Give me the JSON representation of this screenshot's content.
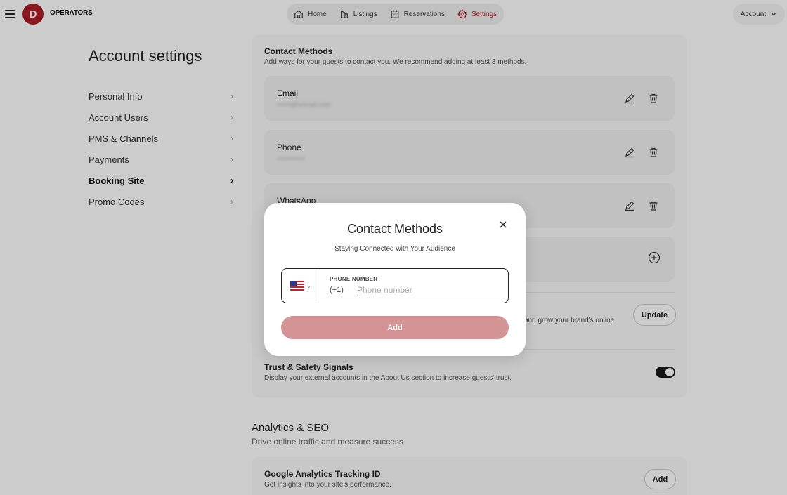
{
  "brand": {
    "logo_letter": "D",
    "name": "OPERATORS"
  },
  "nav": {
    "items": [
      {
        "label": "Home",
        "icon": "home-icon"
      },
      {
        "label": "Listings",
        "icon": "listings-icon"
      },
      {
        "label": "Reservations",
        "icon": "calendar-icon"
      },
      {
        "label": "Settings",
        "icon": "gear-icon",
        "active": true
      }
    ],
    "account_label": "Account"
  },
  "page": {
    "title": "Account settings"
  },
  "sidebar": {
    "items": [
      {
        "label": "Personal Info"
      },
      {
        "label": "Account Users"
      },
      {
        "label": "PMS & Channels"
      },
      {
        "label": "Payments"
      },
      {
        "label": "Booking Site",
        "active": true
      },
      {
        "label": "Promo Codes"
      }
    ]
  },
  "contact": {
    "title": "Contact Methods",
    "subtitle": "Add ways for your guests to contact you. We recommend adding at least 3 methods.",
    "methods": [
      {
        "label": "Email",
        "value": "••••••@hotmail.com"
      },
      {
        "label": "Phone",
        "value": "+•••••••••••"
      },
      {
        "label": "WhatsApp",
        "value": ""
      }
    ]
  },
  "domain_section": {
    "partial_text": "and grow your brand's online",
    "update_label": "Update"
  },
  "trust": {
    "title": "Trust & Safety Signals",
    "subtitle": "Display your external accounts in the About Us section to increase guests' trust.",
    "enabled": true
  },
  "analytics": {
    "title": "Analytics & SEO",
    "subtitle": "Drive online traffic and measure success",
    "ga_title": "Google Analytics Tracking ID",
    "ga_subtitle": "Get insights into your site's performance.",
    "ga_add_label": "Add"
  },
  "modal": {
    "title": "Contact Methods",
    "subtitle": "Staying Connected with Your Audience",
    "phone_label": "PHONE NUMBER",
    "country_code": "(+1)",
    "phone_placeholder": "Phone number",
    "phone_value": "",
    "add_label": "Add",
    "add_color": "#d49496"
  },
  "colors": {
    "accent": "#b01e2a"
  }
}
